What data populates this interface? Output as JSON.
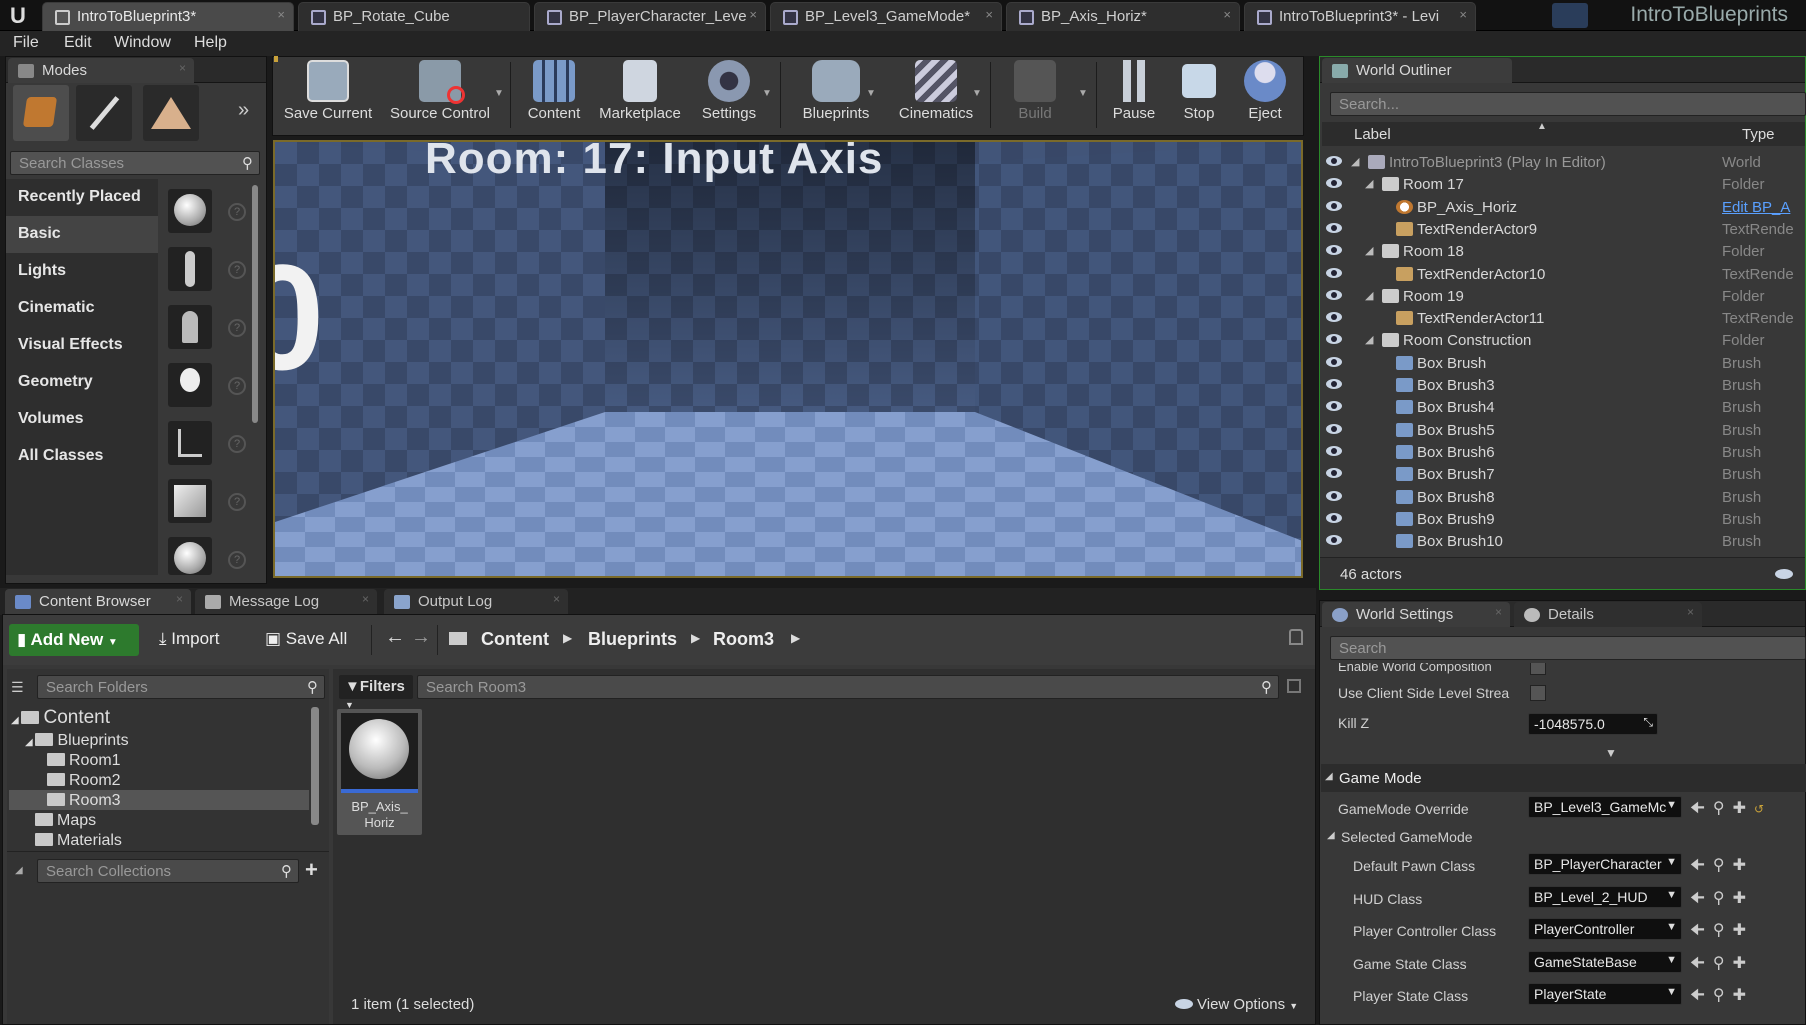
{
  "titlebar": {
    "tabs": [
      {
        "label": "IntroToBlueprint3*",
        "active": true
      },
      {
        "label": "BP_Rotate_Cube"
      },
      {
        "label": "BP_PlayerCharacter_Leve"
      },
      {
        "label": "BP_Level3_GameMode*"
      },
      {
        "label": "BP_Axis_Horiz*"
      },
      {
        "label": "IntroToBlueprint3* - Levi"
      }
    ],
    "app_title": "IntroToBlueprints"
  },
  "menubar": {
    "items": [
      "File",
      "Edit",
      "Window",
      "Help"
    ]
  },
  "modes": {
    "title": "Modes",
    "search_placeholder": "Search Classes",
    "categories": [
      "Recently Placed",
      "Basic",
      "Lights",
      "Cinematic",
      "Visual Effects",
      "Geometry",
      "Volumes",
      "All Classes"
    ],
    "selected_category": "Basic"
  },
  "toolbar": {
    "buttons": [
      "Save Current",
      "Source Control",
      "Content",
      "Marketplace",
      "Settings",
      "Blueprints",
      "Cinematics",
      "Build",
      "Pause",
      "Stop",
      "Eject"
    ]
  },
  "viewport": {
    "text": "Room: 17: Input Axis",
    "left_digit": "0"
  },
  "outliner": {
    "title": "World Outliner",
    "search_placeholder": "Search...",
    "col_label": "Label",
    "col_type": "Type",
    "rows": [
      {
        "name": "IntroToBlueprint3 (Play In Editor)",
        "type": "World",
        "indent": 0
      },
      {
        "name": "Room 17",
        "type": "Folder",
        "indent": 1
      },
      {
        "name": "BP_Axis_Horiz",
        "type": "Edit BP_A",
        "indent": 2
      },
      {
        "name": "TextRenderActor9",
        "type": "TextRende",
        "indent": 2
      },
      {
        "name": "Room 18",
        "type": "Folder",
        "indent": 1
      },
      {
        "name": "TextRenderActor10",
        "type": "TextRende",
        "indent": 2
      },
      {
        "name": "Room 19",
        "type": "Folder",
        "indent": 1
      },
      {
        "name": "TextRenderActor11",
        "type": "TextRende",
        "indent": 2
      },
      {
        "name": "Room Construction",
        "type": "Folder",
        "indent": 1
      },
      {
        "name": "Box Brush",
        "type": "Brush",
        "indent": 2
      },
      {
        "name": "Box Brush3",
        "type": "Brush",
        "indent": 2
      },
      {
        "name": "Box Brush4",
        "type": "Brush",
        "indent": 2
      },
      {
        "name": "Box Brush5",
        "type": "Brush",
        "indent": 2
      },
      {
        "name": "Box Brush6",
        "type": "Brush",
        "indent": 2
      },
      {
        "name": "Box Brush7",
        "type": "Brush",
        "indent": 2
      },
      {
        "name": "Box Brush8",
        "type": "Brush",
        "indent": 2
      },
      {
        "name": "Box Brush9",
        "type": "Brush",
        "indent": 2
      },
      {
        "name": "Box Brush10",
        "type": "Brush",
        "indent": 2
      }
    ],
    "actor_count": "46 actors"
  },
  "bottom_tabs": {
    "content_browser": "Content Browser",
    "message_log": "Message Log",
    "output_log": "Output Log"
  },
  "content_browser": {
    "add_new": "Add New",
    "import": "Import",
    "save_all": "Save All",
    "path": [
      "Content",
      "Blueprints",
      "Room3"
    ],
    "search_folders": "Search Folders",
    "filters": "Filters",
    "search_assets": "Search Room3",
    "search_collections": "Search Collections",
    "tree": [
      {
        "label": "Content",
        "level": 0
      },
      {
        "label": "Blueprints",
        "level": 1
      },
      {
        "label": "Room1",
        "level": 2
      },
      {
        "label": "Room2",
        "level": 2
      },
      {
        "label": "Room3",
        "level": 2,
        "selected": true
      },
      {
        "label": "Maps",
        "level": 1
      },
      {
        "label": "Materials",
        "level": 1
      }
    ],
    "asset_label": "BP_Axis_\nHoriz",
    "status": "1 item (1 selected)",
    "view_options": "View Options"
  },
  "details": {
    "tab_world_settings": "World Settings",
    "tab_details": "Details",
    "search_placeholder": "Search",
    "enable_world_composition": "Enable World Composition",
    "use_client_side": "Use Client Side Level Strea",
    "kill_z_label": "Kill Z",
    "kill_z_value": "-1048575.0",
    "game_mode_header": "Game Mode",
    "gamemode_override_label": "GameMode Override",
    "gamemode_override_value": "BP_Level3_GameMc",
    "selected_gamemode": "Selected GameMode",
    "rows": [
      {
        "label": "Default Pawn Class",
        "value": "BP_PlayerCharacter"
      },
      {
        "label": "HUD Class",
        "value": "BP_Level_2_HUD"
      },
      {
        "label": "Player Controller Class",
        "value": "PlayerController"
      },
      {
        "label": "Game State Class",
        "value": "GameStateBase"
      },
      {
        "label": "Player State Class",
        "value": "PlayerState"
      }
    ]
  }
}
